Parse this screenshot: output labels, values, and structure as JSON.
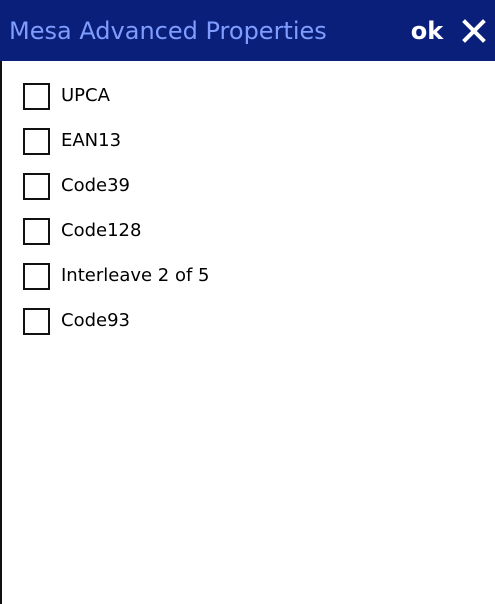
{
  "window": {
    "title": "Mesa Advanced Properties",
    "ok_label": "ok",
    "close_icon": "close-icon"
  },
  "options": [
    {
      "label": "UPCA",
      "checked": false
    },
    {
      "label": "EAN13",
      "checked": false
    },
    {
      "label": "Code39",
      "checked": false
    },
    {
      "label": "Code128",
      "checked": false
    },
    {
      "label": "Interleave 2 of 5",
      "checked": false
    },
    {
      "label": "Code93",
      "checked": false
    }
  ],
  "colors": {
    "titlebar": "#0a1f7a",
    "title_text": "#7f9cff",
    "background": "#ffffff"
  }
}
